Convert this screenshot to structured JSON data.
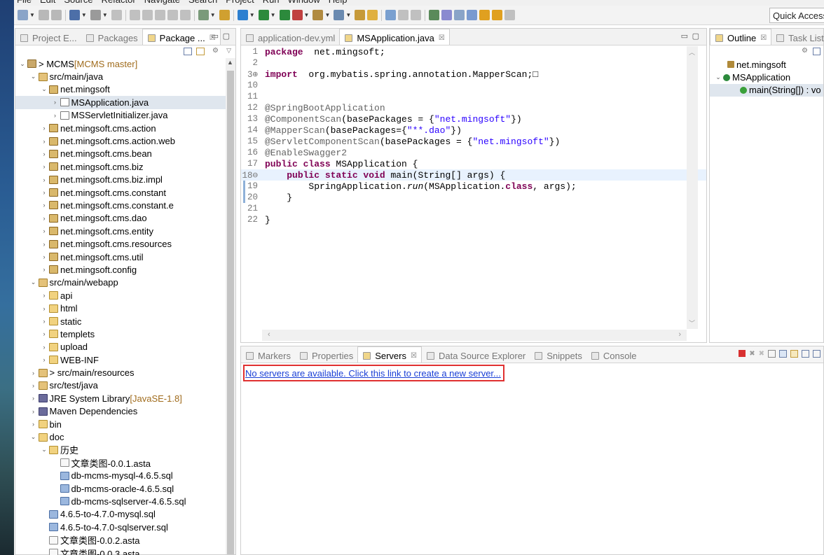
{
  "menu": [
    "File",
    "Edit",
    "Source",
    "Refactor",
    "Navigate",
    "Search",
    "Project",
    "Run",
    "Window",
    "Help"
  ],
  "quick_access": "Quick Access",
  "left_panel": {
    "tabs": [
      {
        "label": "Project E...",
        "active": false
      },
      {
        "label": "Packages",
        "active": false
      },
      {
        "label": "Package ...",
        "active": true
      }
    ]
  },
  "tree": [
    {
      "label": "> MCMS",
      "suffix": " [MCMS master]",
      "indent": 0,
      "twisty": "open",
      "icon": "proj"
    },
    {
      "label": "src/main/java",
      "indent": 1,
      "twisty": "open",
      "icon": "srcf"
    },
    {
      "label": "net.mingsoft",
      "indent": 2,
      "twisty": "open",
      "icon": "pkg"
    },
    {
      "label": "MSApplication.java",
      "indent": 3,
      "twisty": "closed",
      "icon": "java",
      "selected": true
    },
    {
      "label": "MSServletInitializer.java",
      "indent": 3,
      "twisty": "closed",
      "icon": "java"
    },
    {
      "label": "net.mingsoft.cms.action",
      "indent": 2,
      "twisty": "closed",
      "icon": "pkg"
    },
    {
      "label": "net.mingsoft.cms.action.web",
      "indent": 2,
      "twisty": "closed",
      "icon": "pkg"
    },
    {
      "label": "net.mingsoft.cms.bean",
      "indent": 2,
      "twisty": "closed",
      "icon": "pkg"
    },
    {
      "label": "net.mingsoft.cms.biz",
      "indent": 2,
      "twisty": "closed",
      "icon": "pkg"
    },
    {
      "label": "net.mingsoft.cms.biz.impl",
      "indent": 2,
      "twisty": "closed",
      "icon": "pkg"
    },
    {
      "label": "net.mingsoft.cms.constant",
      "indent": 2,
      "twisty": "closed",
      "icon": "pkg"
    },
    {
      "label": "net.mingsoft.cms.constant.e",
      "indent": 2,
      "twisty": "closed",
      "icon": "pkg"
    },
    {
      "label": "net.mingsoft.cms.dao",
      "indent": 2,
      "twisty": "closed",
      "icon": "pkg"
    },
    {
      "label": "net.mingsoft.cms.entity",
      "indent": 2,
      "twisty": "closed",
      "icon": "pkg"
    },
    {
      "label": "net.mingsoft.cms.resources",
      "indent": 2,
      "twisty": "closed",
      "icon": "pkg"
    },
    {
      "label": "net.mingsoft.cms.util",
      "indent": 2,
      "twisty": "closed",
      "icon": "pkg"
    },
    {
      "label": "net.mingsoft.config",
      "indent": 2,
      "twisty": "closed",
      "icon": "pkg"
    },
    {
      "label": "src/main/webapp",
      "indent": 1,
      "twisty": "open",
      "icon": "srcf"
    },
    {
      "label": "api",
      "indent": 2,
      "twisty": "closed",
      "icon": "fold"
    },
    {
      "label": "html",
      "indent": 2,
      "twisty": "closed",
      "icon": "fold"
    },
    {
      "label": "static",
      "indent": 2,
      "twisty": "closed",
      "icon": "fold"
    },
    {
      "label": "templets",
      "indent": 2,
      "twisty": "closed",
      "icon": "fold"
    },
    {
      "label": "upload",
      "indent": 2,
      "twisty": "closed",
      "icon": "fold"
    },
    {
      "label": "WEB-INF",
      "indent": 2,
      "twisty": "closed",
      "icon": "fold"
    },
    {
      "label": "> src/main/resources",
      "indent": 1,
      "twisty": "closed",
      "icon": "srcf"
    },
    {
      "label": "src/test/java",
      "indent": 1,
      "twisty": "closed",
      "icon": "srcf"
    },
    {
      "label": "JRE System Library",
      "suffix": " [JavaSE-1.8]",
      "indent": 1,
      "twisty": "closed",
      "icon": "lib"
    },
    {
      "label": "Maven Dependencies",
      "indent": 1,
      "twisty": "closed",
      "icon": "lib"
    },
    {
      "label": "bin",
      "indent": 1,
      "twisty": "closed",
      "icon": "fold"
    },
    {
      "label": "doc",
      "indent": 1,
      "twisty": "open",
      "icon": "fold"
    },
    {
      "label": "历史",
      "indent": 2,
      "twisty": "open",
      "icon": "fold"
    },
    {
      "label": "文章类图-0.0.1.asta",
      "indent": 3,
      "twisty": "",
      "icon": "file"
    },
    {
      "label": "db-mcms-mysql-4.6.5.sql",
      "indent": 3,
      "twisty": "",
      "icon": "sql"
    },
    {
      "label": "db-mcms-oracle-4.6.5.sql",
      "indent": 3,
      "twisty": "",
      "icon": "sql"
    },
    {
      "label": "db-mcms-sqlserver-4.6.5.sql",
      "indent": 3,
      "twisty": "",
      "icon": "sql"
    },
    {
      "label": "4.6.5-to-4.7.0-mysql.sql",
      "indent": 2,
      "twisty": "",
      "icon": "sql"
    },
    {
      "label": "4.6.5-to-4.7.0-sqlserver.sql",
      "indent": 2,
      "twisty": "",
      "icon": "sql"
    },
    {
      "label": "文章类图-0.0.2.asta",
      "indent": 2,
      "twisty": "",
      "icon": "file"
    },
    {
      "label": "文章类图-0.0.3.asta",
      "indent": 2,
      "twisty": "",
      "icon": "file"
    }
  ],
  "editor": {
    "tabs": [
      {
        "label": "application-dev.yml",
        "active": false
      },
      {
        "label": "MSApplication.java",
        "active": true
      }
    ],
    "lines": [
      {
        "n": "1",
        "parts": [
          [
            "kw",
            "package"
          ],
          [
            "",
            "  net.mingsoft;"
          ]
        ]
      },
      {
        "n": "2",
        "parts": []
      },
      {
        "n": "3⊕",
        "parts": [
          [
            "kw",
            "import"
          ],
          [
            "",
            "  org.mybatis.spring.annotation.MapperScan;"
          ],
          [
            "",
            "□"
          ]
        ]
      },
      {
        "n": "10",
        "parts": []
      },
      {
        "n": "11",
        "parts": []
      },
      {
        "n": "12",
        "parts": [
          [
            "an",
            "@SpringBootApplication"
          ]
        ]
      },
      {
        "n": "13",
        "parts": [
          [
            "an",
            "@ComponentScan"
          ],
          [
            "",
            "(basePackages = {"
          ],
          [
            "st",
            "\"net.mingsoft\""
          ],
          [
            "",
            "})"
          ]
        ]
      },
      {
        "n": "14",
        "parts": [
          [
            "an",
            "@MapperScan"
          ],
          [
            "",
            "(basePackages={"
          ],
          [
            "st",
            "\"**.dao\""
          ],
          [
            "",
            "})"
          ]
        ]
      },
      {
        "n": "15",
        "parts": [
          [
            "an",
            "@ServletComponentScan"
          ],
          [
            "",
            "(basePackages = {"
          ],
          [
            "st",
            "\"net.mingsoft\""
          ],
          [
            "",
            "})"
          ]
        ]
      },
      {
        "n": "16",
        "parts": [
          [
            "an",
            "@EnableSwagger2"
          ]
        ]
      },
      {
        "n": "17",
        "parts": [
          [
            "kw",
            "public class"
          ],
          [
            "",
            " MSApplication {"
          ]
        ]
      },
      {
        "n": "18⊖",
        "current": true,
        "parts": [
          [
            "",
            "    "
          ],
          [
            "kw",
            "public static void"
          ],
          [
            "",
            " main(String[] args) {"
          ]
        ]
      },
      {
        "n": "19",
        "parts": [
          [
            "",
            "        SpringApplication."
          ],
          [
            "it",
            "run"
          ],
          [
            "",
            "(MSApplication."
          ],
          [
            "kw",
            "class"
          ],
          [
            "",
            ", args);"
          ]
        ]
      },
      {
        "n": "20",
        "parts": [
          [
            "",
            "    }"
          ]
        ]
      },
      {
        "n": "21",
        "parts": []
      },
      {
        "n": "22",
        "parts": [
          [
            "",
            "}"
          ]
        ]
      }
    ]
  },
  "outline": {
    "tabs": [
      {
        "label": "Outline",
        "active": true
      },
      {
        "label": "Task List",
        "active": false
      }
    ],
    "items": [
      {
        "label": "net.mingsoft",
        "indent": 1
      },
      {
        "label": "MSApplication",
        "indent": 0
      },
      {
        "label": "main(String[]) : vo",
        "indent": 2
      }
    ]
  },
  "bottom": {
    "tabs": [
      {
        "label": "Markers",
        "active": false
      },
      {
        "label": "Properties",
        "active": false
      },
      {
        "label": "Servers",
        "active": true
      },
      {
        "label": "Data Source Explorer",
        "active": false
      },
      {
        "label": "Snippets",
        "active": false
      },
      {
        "label": "Console",
        "active": false
      }
    ],
    "servers_message": "No servers are available. Click this link to create a new server..."
  }
}
